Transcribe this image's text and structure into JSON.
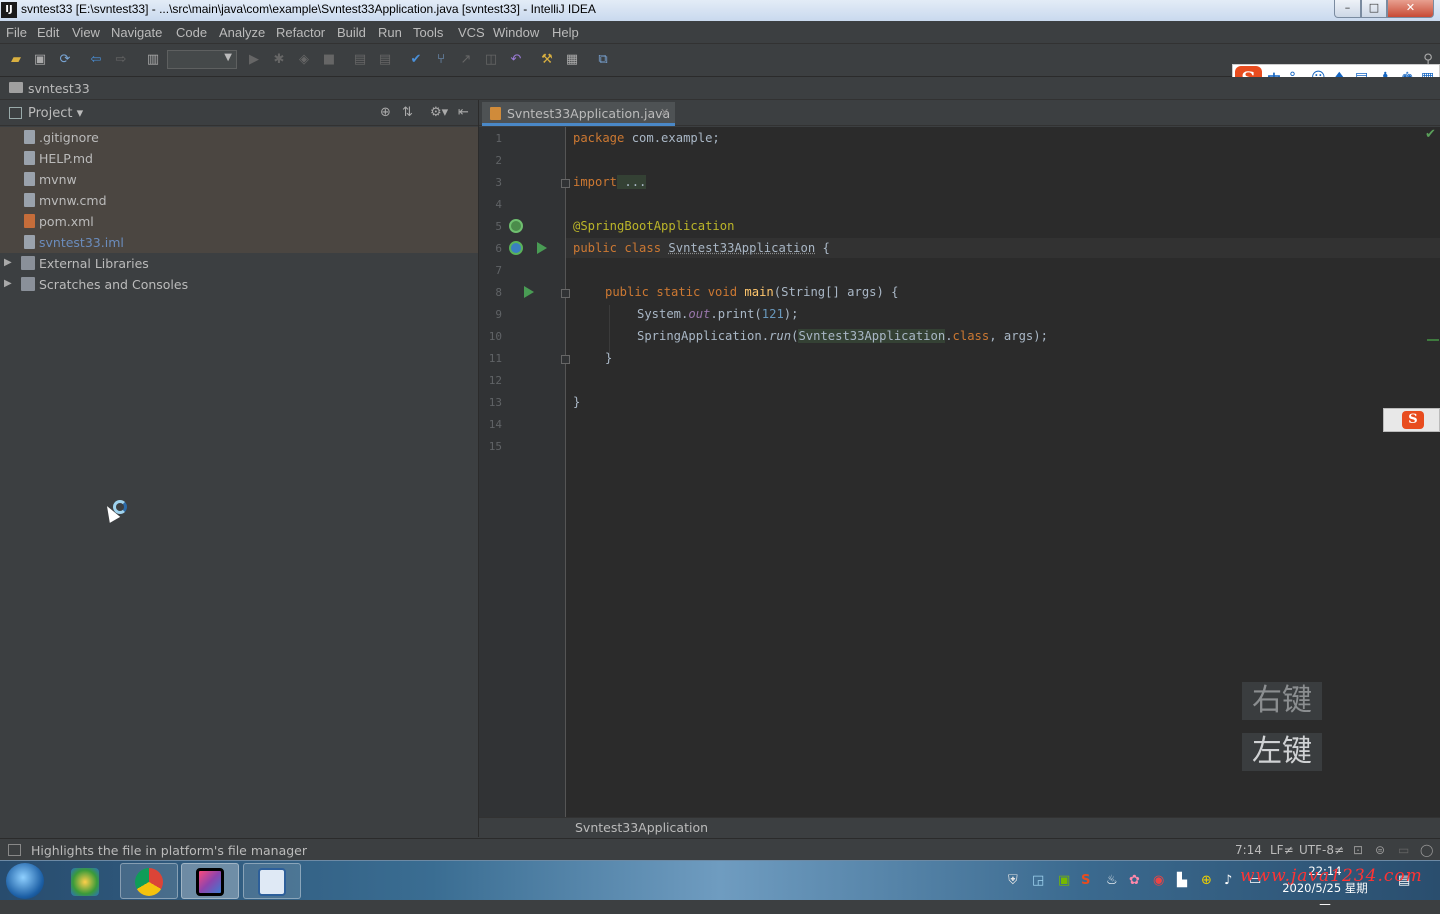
{
  "window": {
    "title": "svntest33 [E:\\svntest33] - ...\\src\\main\\java\\com\\example\\Svntest33Application.java [svntest33] - IntelliJ IDEA",
    "app_icon": "IJ",
    "minimize": "–",
    "maximize": "□",
    "close": "✕"
  },
  "menu": [
    "File",
    "Edit",
    "View",
    "Navigate",
    "Code",
    "Analyze",
    "Refactor",
    "Build",
    "Run",
    "Tools",
    "VCS",
    "Window",
    "Help"
  ],
  "navbar": {
    "crumb": "svntest33"
  },
  "project_panel": {
    "title": "Project",
    "files": [
      ".gitignore",
      "HELP.md",
      "mvnw",
      "mvnw.cmd",
      "pom.xml",
      "svntest33.iml"
    ],
    "nodes": [
      "External Libraries",
      "Scratches and Consoles"
    ]
  },
  "editor": {
    "tab_label": "Svntest33Application.java",
    "line_numbers": [
      "1",
      "2",
      "3",
      "4",
      "5",
      "6",
      "7",
      "8",
      "9",
      "10",
      "11",
      "12",
      "13",
      "14",
      "15"
    ],
    "code": {
      "l1_kw": "package",
      "l1_rest": " com.example;",
      "l3_kw": "import",
      "l3_rest": " ...",
      "l6": "@SpringBootApplication",
      "l7_kw": "public class",
      "l7_cls": "Svntest33Application",
      "l7_rest": " {",
      "l9_kw": "public static void",
      "l9_fn": "main",
      "l9_rest": "(String[] args) {",
      "l10_a": "System.",
      "l10_fld": "out",
      "l10_b": ".print(",
      "l10_num": "121",
      "l10_c": ");",
      "l11_a": "SpringApplication.",
      "l11_run": "run",
      "l11_b": "(",
      "l11_cls": "Svntest33Application",
      "l11_c": ".",
      "l11_kw": "class",
      "l11_d": ", args);",
      "l12": "}",
      "l14": "}"
    },
    "breadcrumb": "Svntest33Application"
  },
  "status": {
    "message": "Highlights the file in platform's file manager",
    "position": "7:14",
    "line_sep": "LF≠",
    "encoding": "UTF-8≠"
  },
  "overlay": {
    "right_key": "右键",
    "left_key": "左键"
  },
  "ime": {
    "logo": "S",
    "lang": "中"
  },
  "taskbar": {
    "time": "22:14",
    "date": "2020/5/25 星期一"
  },
  "watermark": "www.java1234.com",
  "colors": {
    "keyword": "#cc7832",
    "annotation": "#bbb529",
    "method": "#ffc66d",
    "number": "#6897bb",
    "field": "#9876aa"
  }
}
